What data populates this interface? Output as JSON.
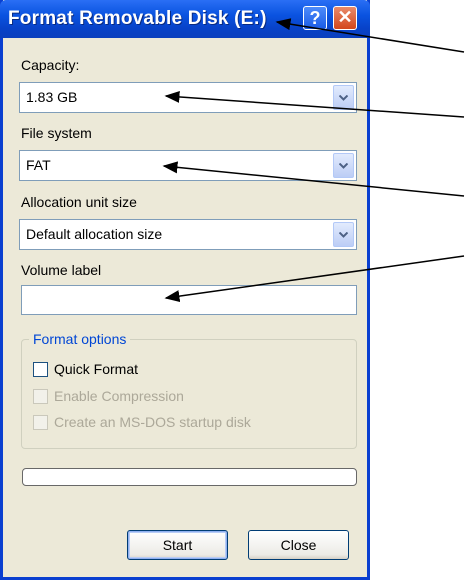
{
  "window": {
    "title": "Format Removable Disk (E:)",
    "help_glyph": "?",
    "close_glyph": "✕"
  },
  "capacity": {
    "label": "Capacity:",
    "value": "1.83 GB"
  },
  "file_system": {
    "label": "File system",
    "value": "FAT"
  },
  "allocation": {
    "label": "Allocation unit size",
    "value": "Default allocation size"
  },
  "volume": {
    "label": "Volume label",
    "value": ""
  },
  "format_options": {
    "legend": "Format options",
    "options": [
      {
        "label": "Quick Format",
        "checked": false,
        "enabled": true
      },
      {
        "label": "Enable Compression",
        "checked": false,
        "enabled": false
      },
      {
        "label": "Create an MS-DOS startup disk",
        "checked": false,
        "enabled": false
      }
    ]
  },
  "progress": {
    "fraction": 0
  },
  "buttons": {
    "start": "Start",
    "close": "Close"
  },
  "colors": {
    "titlebar": "#0a53e0",
    "dialog_bg": "#ece9d8",
    "group_legend": "#0046d5",
    "annotation_arrow": "#000000"
  }
}
